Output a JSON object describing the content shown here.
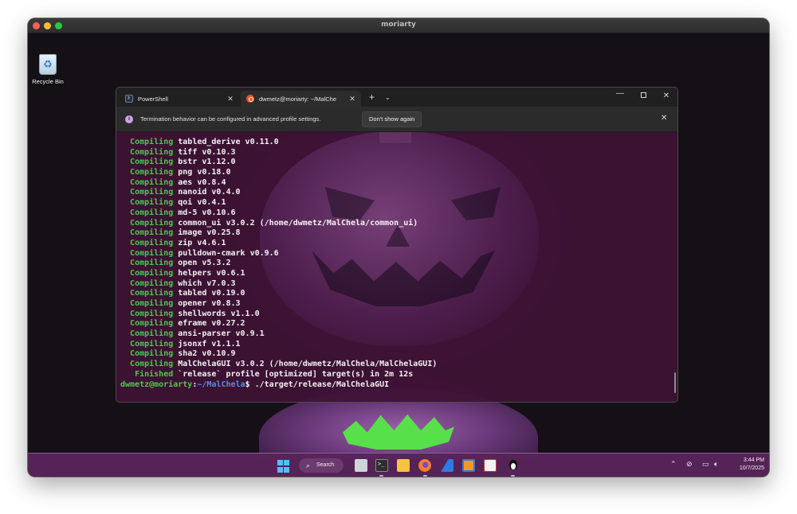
{
  "mac_window": {
    "title": "moriarty"
  },
  "desktop": {
    "recycle_bin_label": "Recycle Bin"
  },
  "terminal": {
    "tabs": [
      {
        "title": "PowerShell",
        "icon": "powershell-icon",
        "active": false
      },
      {
        "title": "dwmetz@moriarty: ~/MalChe",
        "icon": "ubuntu-icon",
        "active": true
      }
    ],
    "new_tab_label": "+",
    "dropdown_label": "⌄",
    "window_controls": {
      "minimize": "—",
      "close": "✕"
    },
    "infobar": {
      "message": "Termination behavior can be configured in advanced profile settings.",
      "button_label": "Don't show again",
      "close": "✕"
    },
    "console_lines": [
      {
        "kw": "Compiling",
        "text": " tabled_derive v0.11.0"
      },
      {
        "kw": "Compiling",
        "text": " tiff v0.10.3"
      },
      {
        "kw": "Compiling",
        "text": " bstr v1.12.0"
      },
      {
        "kw": "Compiling",
        "text": " png v0.18.0"
      },
      {
        "kw": "Compiling",
        "text": " aes v0.8.4"
      },
      {
        "kw": "Compiling",
        "text": " nanoid v0.4.0"
      },
      {
        "kw": "Compiling",
        "text": " qoi v0.4.1"
      },
      {
        "kw": "Compiling",
        "text": " md-5 v0.10.6"
      },
      {
        "kw": "Compiling",
        "text": " common_ui v3.0.2 (/home/dwmetz/MalChela/common_ui)"
      },
      {
        "kw": "Compiling",
        "text": " image v0.25.8"
      },
      {
        "kw": "Compiling",
        "text": " zip v4.6.1"
      },
      {
        "kw": "Compiling",
        "text": " pulldown-cmark v0.9.6"
      },
      {
        "kw": "Compiling",
        "text": " open v5.3.2"
      },
      {
        "kw": "Compiling",
        "text": " helpers v0.6.1"
      },
      {
        "kw": "Compiling",
        "text": " which v7.0.3"
      },
      {
        "kw": "Compiling",
        "text": " tabled v0.19.0"
      },
      {
        "kw": "Compiling",
        "text": " opener v0.8.3"
      },
      {
        "kw": "Compiling",
        "text": " shellwords v1.1.0"
      },
      {
        "kw": "Compiling",
        "text": " eframe v0.27.2"
      },
      {
        "kw": "Compiling",
        "text": " ansi-parser v0.9.1"
      },
      {
        "kw": "Compiling",
        "text": " jsonxf v1.1.1"
      },
      {
        "kw": "Compiling",
        "text": " sha2 v0.10.9"
      },
      {
        "kw": "Compiling",
        "text": " MalChelaGUI v3.0.2 (/home/dwmetz/MalChela/MalChelaGUI)"
      },
      {
        "kw": " Finished",
        "text": " `release` profile [optimized] target(s) in 2m 12s"
      }
    ],
    "prompt": {
      "user_host": "dwmetz@moriarty",
      "separator": ":",
      "path": "~/MalChela",
      "symbol": "$",
      "command": " ./target/release/MalChelaGUI"
    }
  },
  "taskbar": {
    "search_label": "Search",
    "apps": [
      "start-icon",
      "file-manager-icon",
      "terminal-icon",
      "file-explorer-icon",
      "firefox-icon",
      "app-icon",
      "app-icon",
      "app-icon",
      "linux-icon"
    ],
    "clock": {
      "time": "3:44 PM",
      "date": "10/7/2025"
    }
  },
  "colors": {
    "accent_green": "#4ec94e",
    "prompt_blue": "#5b8be8",
    "taskbar": "#58245a",
    "terminal_bg": "#401236"
  }
}
